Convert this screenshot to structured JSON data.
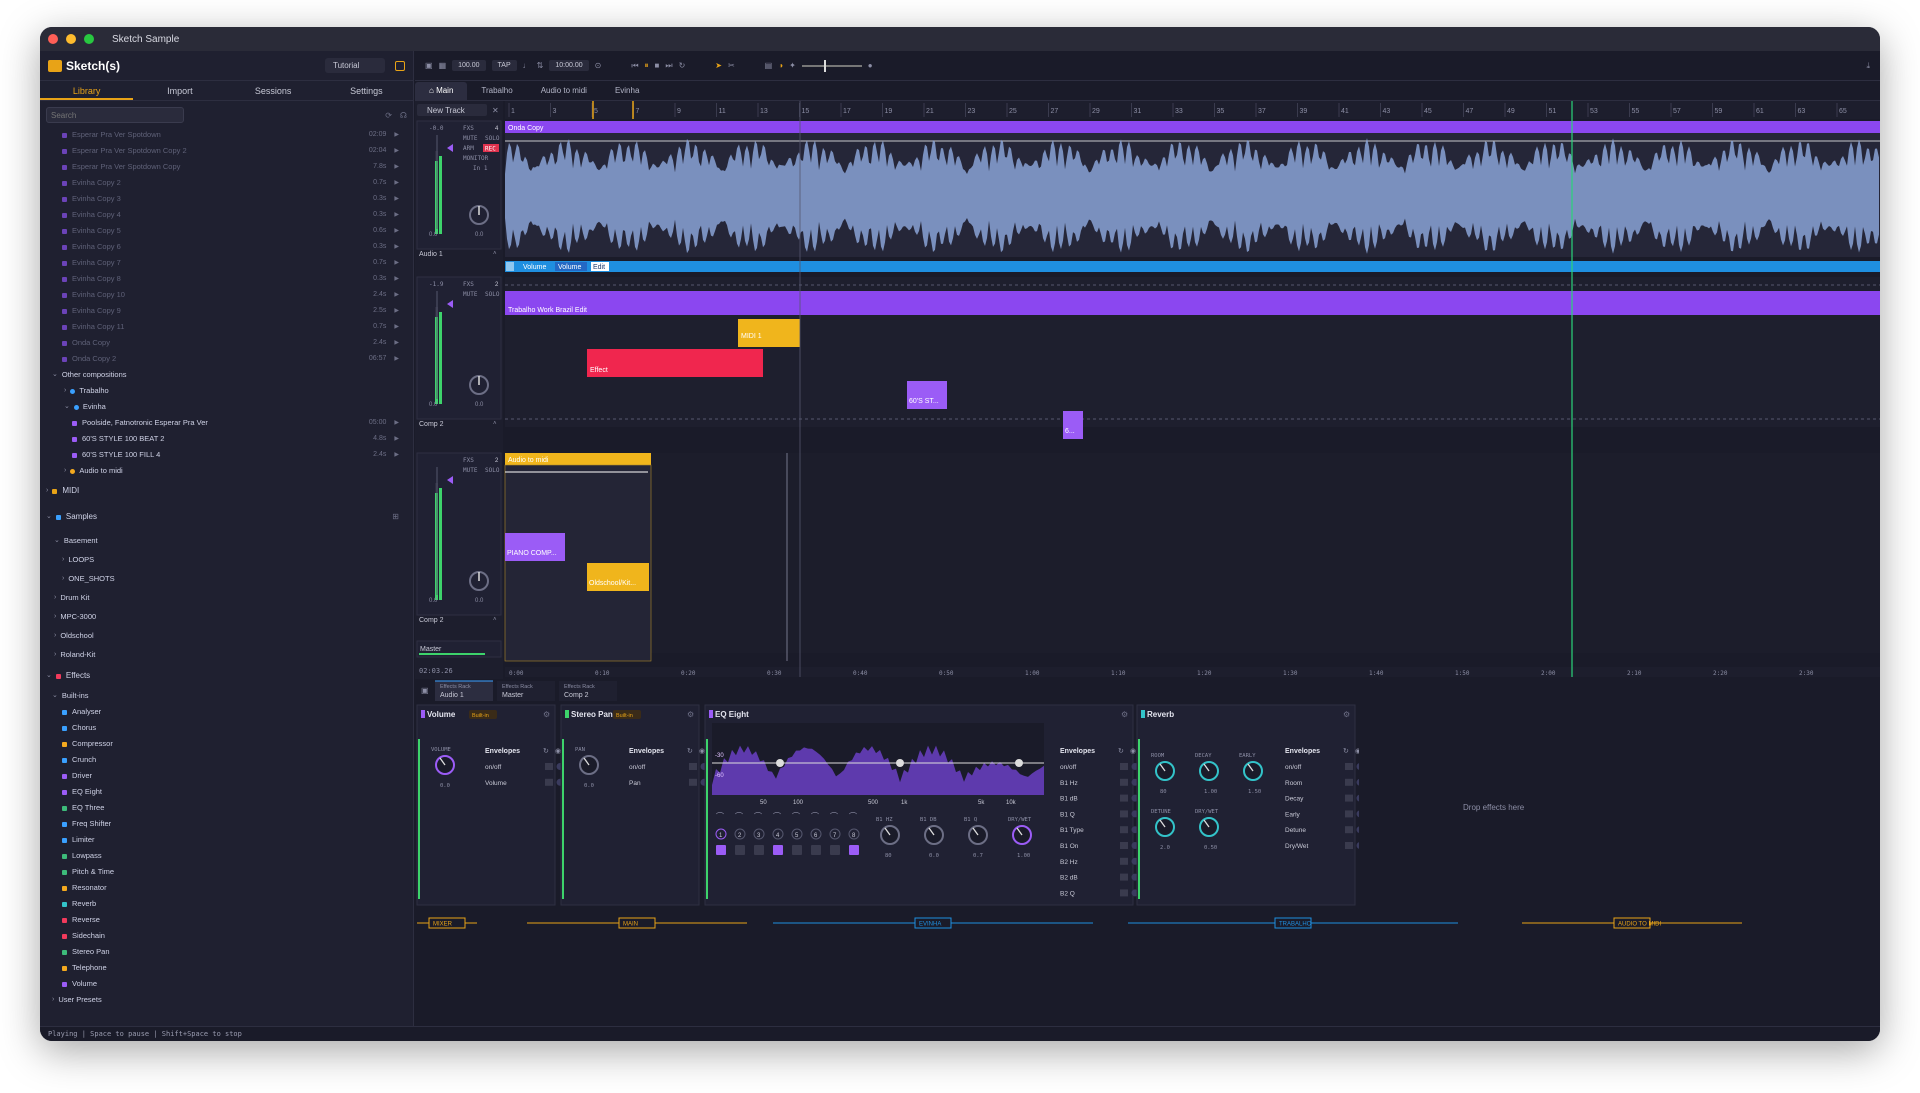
{
  "window": {
    "title": "Sketch Sample"
  },
  "sidebar": {
    "logo": "Sketch(s)",
    "project": "Tutorial",
    "tabs": [
      "Library",
      "Import",
      "Sessions",
      "Settings"
    ],
    "search_placeholder": "Search",
    "library_items": [
      {
        "name": "Esperar Pra Ver Spotdown",
        "dur": "02:09",
        "color": "#6b43b8"
      },
      {
        "name": "Esperar Pra Ver Spotdown Copy 2",
        "dur": "02:04",
        "color": "#6b43b8"
      },
      {
        "name": "Esperar Pra Ver Spotdown Copy",
        "dur": "7.8s",
        "color": "#6b43b8"
      },
      {
        "name": "Evinha Copy 2",
        "dur": "0.7s",
        "color": "#6b43b8"
      },
      {
        "name": "Evinha Copy 3",
        "dur": "0.3s",
        "color": "#6b43b8"
      },
      {
        "name": "Evinha Copy 4",
        "dur": "0.3s",
        "color": "#6b43b8"
      },
      {
        "name": "Evinha Copy 5",
        "dur": "0.6s",
        "color": "#6b43b8"
      },
      {
        "name": "Evinha Copy 6",
        "dur": "0.3s",
        "color": "#6b43b8"
      },
      {
        "name": "Evinha Copy 7",
        "dur": "0.7s",
        "color": "#6b43b8"
      },
      {
        "name": "Evinha Copy 8",
        "dur": "0.3s",
        "color": "#6b43b8"
      },
      {
        "name": "Evinha Copy 10",
        "dur": "2.4s",
        "color": "#6b43b8"
      },
      {
        "name": "Evinha Copy 9",
        "dur": "2.5s",
        "color": "#6b43b8"
      },
      {
        "name": "Evinha Copy 11",
        "dur": "0.7s",
        "color": "#6b43b8"
      },
      {
        "name": "Onda Copy",
        "dur": "2.4s",
        "color": "#6b43b8"
      },
      {
        "name": "Onda Copy 2",
        "dur": "06:57",
        "color": "#6b43b8"
      }
    ],
    "other_compositions": "Other compositions",
    "comp_trabalho": "Trabalho",
    "comp_evinha": "Evinha",
    "evinha_items": [
      {
        "name": "Poolside, Fatnotronic Esperar Pra Ver",
        "dur": "05:00"
      },
      {
        "name": "60'S STYLE 100 BEAT 2",
        "dur": "4.8s"
      },
      {
        "name": "60'S STYLE 100 FILL 4",
        "dur": "2.4s"
      }
    ],
    "comp_audio_to_midi": "Audio to midi",
    "midi": "MIDI",
    "samples": "Samples",
    "sample_tree": [
      {
        "name": "Basement",
        "indent": 1,
        "open": true
      },
      {
        "name": "LOOPS",
        "indent": 2,
        "open": false
      },
      {
        "name": "ONE_SHOTS",
        "indent": 2,
        "open": false
      },
      {
        "name": "Drum Kit",
        "indent": 1,
        "open": false
      },
      {
        "name": "MPC-3000",
        "indent": 1,
        "open": false
      },
      {
        "name": "Oldschool",
        "indent": 1,
        "open": false
      },
      {
        "name": "Roland-Kit",
        "indent": 1,
        "open": false
      }
    ],
    "effects": "Effects",
    "builtins": "Built-ins",
    "effect_items": [
      {
        "name": "Analyser",
        "color": "#3aa0ff"
      },
      {
        "name": "Chorus",
        "color": "#3aa0ff"
      },
      {
        "name": "Compressor",
        "color": "#f4a91f"
      },
      {
        "name": "Crunch",
        "color": "#3aa0ff"
      },
      {
        "name": "Driver",
        "color": "#9b5cf6"
      },
      {
        "name": "EQ Eight",
        "color": "#9b5cf6"
      },
      {
        "name": "EQ Three",
        "color": "#3dbb7a"
      },
      {
        "name": "Freq Shifter",
        "color": "#3aa0ff"
      },
      {
        "name": "Limiter",
        "color": "#3aa0ff"
      },
      {
        "name": "Lowpass",
        "color": "#3dbb7a"
      },
      {
        "name": "Pitch & Time",
        "color": "#3dbb7a"
      },
      {
        "name": "Resonator",
        "color": "#f4a91f"
      },
      {
        "name": "Reverb",
        "color": "#33c3c9"
      },
      {
        "name": "Reverse",
        "color": "#f23a5c"
      },
      {
        "name": "Sidechain",
        "color": "#f23a5c"
      },
      {
        "name": "Stereo Pan",
        "color": "#3dbb7a"
      },
      {
        "name": "Telephone",
        "color": "#f4a91f"
      },
      {
        "name": "Volume",
        "color": "#9b5cf6"
      }
    ],
    "user_presets": "User Presets"
  },
  "toolbar": {
    "bpm": "100.00",
    "tap": "TAP",
    "time": "10:00.00"
  },
  "comp_tabs": [
    "Main",
    "Trabalho",
    "Audio to midi",
    "Evinha"
  ],
  "timeline": {
    "new_track": "New Track",
    "ruler": [
      "1",
      "3",
      "5",
      "7",
      "9",
      "11",
      "13",
      "15",
      "17",
      "19",
      "21",
      "23",
      "25",
      "27",
      "29",
      "31",
      "33",
      "35",
      "37",
      "39",
      "41",
      "43",
      "45",
      "47",
      "49",
      "51",
      "53",
      "55",
      "57",
      "59",
      "61",
      "63",
      "65"
    ],
    "time_ruler": [
      "0:00",
      "0:10",
      "0:20",
      "0:30",
      "0:40",
      "0:50",
      "1:00",
      "1:10",
      "1:20",
      "1:30",
      "1:40",
      "1:50",
      "2:00",
      "2:10",
      "2:20",
      "2:30"
    ],
    "position": "02:03.26"
  },
  "tracks": [
    {
      "name": "Audio 1",
      "fxs": "FXS",
      "count": "4",
      "mute": "MUTE",
      "solo": "SOLO",
      "arm": "ARM",
      "rec": "REC",
      "monitor": "MONITOR",
      "input": "In 1",
      "db": "-0.0",
      "val": "0.0"
    },
    {
      "name": "Comp 2",
      "fxs": "FXS",
      "count": "2",
      "mute": "MUTE",
      "solo": "SOLO",
      "db": "-1.9",
      "val": "0.0"
    },
    {
      "name": "Comp 2",
      "fxs": "FXS",
      "count": "2",
      "mute": "MUTE",
      "solo": "SOLO",
      "db": "",
      "val": "0.0"
    }
  ],
  "master_label": "Master",
  "clips": {
    "onda": "Onda Copy",
    "auto_volume": "Volume",
    "auto_volume2": "Volume",
    "auto_edit": "Edit",
    "trabalho": "Trabalho Work Brazil Edit",
    "midi1": "MIDI 1",
    "effect": "Effect",
    "sixties": "60'S ST...",
    "small": "6...",
    "audio_to_midi": "Audio to midi",
    "piano": "PIANO COMP...",
    "oldschool": "Oldschool/Kit..."
  },
  "rack": {
    "tabs": [
      {
        "label": "Effects Rack",
        "name": "Audio 1"
      },
      {
        "label": "Effects Rack",
        "name": "Master"
      },
      {
        "label": "Effects Rack",
        "name": "Comp 2"
      }
    ],
    "builtin": "Built-in",
    "volume": {
      "title": "Volume",
      "knob": "VOLUME",
      "val": "0.0",
      "env_title": "Envelopes",
      "env": [
        "on/off",
        "Volume"
      ]
    },
    "pan": {
      "title": "Stereo Pan",
      "knob": "PAN",
      "val": "0.0",
      "env_title": "Envelopes",
      "env": [
        "on/off",
        "Pan"
      ]
    },
    "eq": {
      "title": "EQ Eight",
      "dbs": [
        "-30",
        "-60"
      ],
      "freqs": [
        "50",
        "100",
        "500",
        "1k",
        "5k",
        "10k"
      ],
      "bands": [
        "1",
        "2",
        "3",
        "4",
        "5",
        "6",
        "7",
        "8"
      ],
      "knobs": [
        {
          "label": "B1 HZ",
          "val": "80"
        },
        {
          "label": "B1 DB",
          "val": "0.0"
        },
        {
          "label": "B1 Q",
          "val": "0.7"
        },
        {
          "label": "DRY/WET",
          "val": "1.00"
        }
      ],
      "env_title": "Envelopes",
      "env": [
        "on/off",
        "B1 Hz",
        "B1 dB",
        "B1 Q",
        "B1 Type",
        "B1 On",
        "B2 Hz",
        "B2 dB",
        "B2 Q"
      ]
    },
    "reverb": {
      "title": "Reverb",
      "knobs": [
        {
          "label": "ROOM",
          "val": "80"
        },
        {
          "label": "DECAY",
          "val": "1.00"
        },
        {
          "label": "EARLY",
          "val": "1.50"
        },
        {
          "label": "DETUNE",
          "val": "2.0"
        },
        {
          "label": "DRY/WET",
          "val": "0.50"
        }
      ],
      "env_title": "Envelopes",
      "env": [
        "on/off",
        "Room",
        "Decay",
        "Early",
        "Detune",
        "Dry/Wet"
      ]
    },
    "drop": "Drop effects here",
    "markers": [
      "MIXER",
      "MAIN",
      "EVINHA",
      "TRABALHO",
      "AUDIO TO MIDI"
    ]
  },
  "status": "Playing | Space to pause | Shift+Space to stop"
}
